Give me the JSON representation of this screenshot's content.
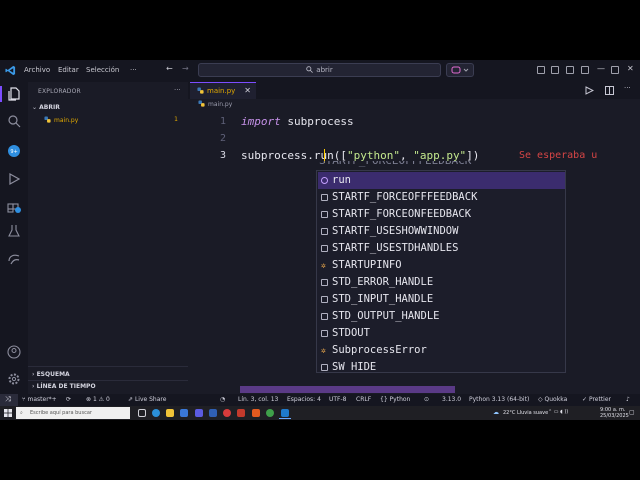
{
  "titlebar": {
    "menus": [
      "Archivo",
      "Editar",
      "Selección"
    ],
    "more": "···",
    "search": "abrir",
    "nav_back": "←",
    "nav_forward": "→"
  },
  "sidebar": {
    "title": "EXPLORADOR",
    "open_section": "ABRIR",
    "files": [
      {
        "name": "main.py",
        "badge": "1"
      }
    ],
    "outline_section": "ESQUEMA",
    "timeline_section": "LÍNEA DE TIEMPO"
  },
  "editor": {
    "tab": {
      "name": "main.py",
      "close": "✕"
    },
    "breadcrumb": "main.py",
    "lines": [
      "1",
      "2",
      "3"
    ],
    "code": {
      "line1_kw": "import",
      "line1_rest": " subprocess",
      "line3_a": "subprocess.run([",
      "line3_s1": "\"python\"",
      "line3_b": ", ",
      "line3_s2": "\"app.py\"",
      "line3_c": "])"
    },
    "hint": "Se esperaba u",
    "ghost": "STARTF_FORCEOFFFEEDBACK"
  },
  "suggestions": [
    {
      "label": "run",
      "kind": "fn",
      "selected": true
    },
    {
      "label": "STARTF_FORCEOFFFEEDBACK",
      "kind": "const"
    },
    {
      "label": "STARTF_FORCEONFEEDBACK",
      "kind": "const"
    },
    {
      "label": "STARTF_USESHOWWINDOW",
      "kind": "const"
    },
    {
      "label": "STARTF_USESTDHANDLES",
      "kind": "const"
    },
    {
      "label": "STARTUPINFO",
      "kind": "cls"
    },
    {
      "label": "STD_ERROR_HANDLE",
      "kind": "const"
    },
    {
      "label": "STD_INPUT_HANDLE",
      "kind": "const"
    },
    {
      "label": "STD_OUTPUT_HANDLE",
      "kind": "const"
    },
    {
      "label": "STDOUT",
      "kind": "const"
    },
    {
      "label": "SubprocessError",
      "kind": "cls"
    },
    {
      "label": "SW_HIDE",
      "kind": "const"
    }
  ],
  "statusbar": {
    "branch": "master*+",
    "errors": "1",
    "warnings": "0",
    "live_share": "Live Share",
    "position": "Lín. 3, col. 13",
    "spaces": "Espacios: 4",
    "encoding": "UTF-8",
    "eol": "CRLF",
    "language": "Python",
    "version": "3.13.0",
    "interpreter": "Python 3.13 (64-bit)",
    "quokka": "Quokka",
    "prettier": "Prettier"
  },
  "taskbar": {
    "search_placeholder": "Escribe aquí para buscar",
    "weather": "22°C  Lluvia suave",
    "time": "9:00 a. m.",
    "date": "25/03/2025"
  },
  "colors": {
    "accent": "#7c4dff",
    "keyword": "#c792ea",
    "string": "#c3e88d",
    "error": "#d64545",
    "modified": "#e0a800"
  }
}
